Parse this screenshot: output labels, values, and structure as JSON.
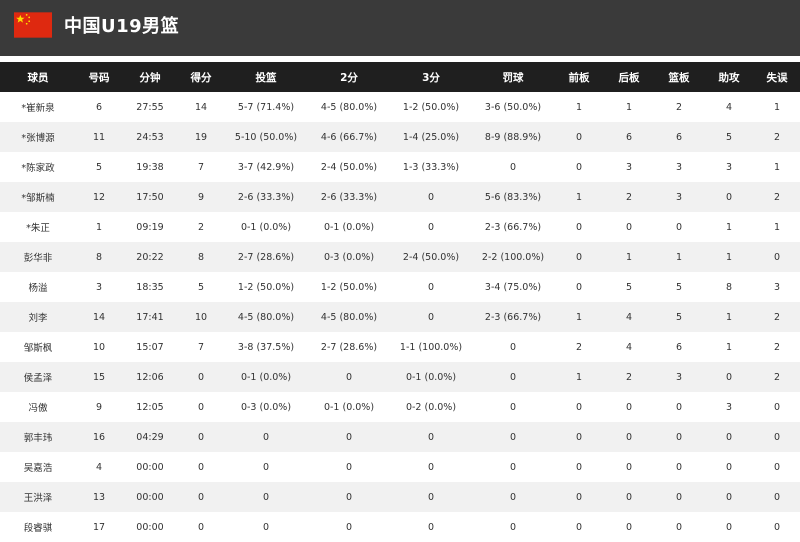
{
  "team": {
    "name": "中国U19男篮",
    "flag_colors": {
      "field": "#de2910",
      "star": "#ffde00"
    }
  },
  "columns": [
    "球员",
    "号码",
    "分钟",
    "得分",
    "投篮",
    "2分",
    "3分",
    "罚球",
    "前板",
    "后板",
    "篮板",
    "助攻",
    "失误"
  ],
  "rows": [
    [
      "*崔新泉",
      "6",
      "27:55",
      "14",
      "5-7 (71.4%)",
      "4-5 (80.0%)",
      "1-2 (50.0%)",
      "3-6 (50.0%)",
      "1",
      "1",
      "2",
      "4",
      "1"
    ],
    [
      "*张博源",
      "11",
      "24:53",
      "19",
      "5-10 (50.0%)",
      "4-6 (66.7%)",
      "1-4 (25.0%)",
      "8-9 (88.9%)",
      "0",
      "6",
      "6",
      "5",
      "2"
    ],
    [
      "*陈家政",
      "5",
      "19:38",
      "7",
      "3-7 (42.9%)",
      "2-4 (50.0%)",
      "1-3 (33.3%)",
      "0",
      "0",
      "3",
      "3",
      "3",
      "1"
    ],
    [
      "*邹斯楠",
      "12",
      "17:50",
      "9",
      "2-6 (33.3%)",
      "2-6 (33.3%)",
      "0",
      "5-6 (83.3%)",
      "1",
      "2",
      "3",
      "0",
      "2"
    ],
    [
      "*朱正",
      "1",
      "09:19",
      "2",
      "0-1 (0.0%)",
      "0-1 (0.0%)",
      "0",
      "2-3 (66.7%)",
      "0",
      "0",
      "0",
      "1",
      "1"
    ],
    [
      "彭华非",
      "8",
      "20:22",
      "8",
      "2-7 (28.6%)",
      "0-3 (0.0%)",
      "2-4 (50.0%)",
      "2-2 (100.0%)",
      "0",
      "1",
      "1",
      "1",
      "0"
    ],
    [
      "杨溢",
      "3",
      "18:35",
      "5",
      "1-2 (50.0%)",
      "1-2 (50.0%)",
      "0",
      "3-4 (75.0%)",
      "0",
      "5",
      "5",
      "8",
      "3"
    ],
    [
      "刘李",
      "14",
      "17:41",
      "10",
      "4-5 (80.0%)",
      "4-5 (80.0%)",
      "0",
      "2-3 (66.7%)",
      "1",
      "4",
      "5",
      "1",
      "2"
    ],
    [
      "邹斯枫",
      "10",
      "15:07",
      "7",
      "3-8 (37.5%)",
      "2-7 (28.6%)",
      "1-1 (100.0%)",
      "0",
      "2",
      "4",
      "6",
      "1",
      "2"
    ],
    [
      "侯孟泽",
      "15",
      "12:06",
      "0",
      "0-1 (0.0%)",
      "0",
      "0-1 (0.0%)",
      "0",
      "1",
      "2",
      "3",
      "0",
      "2"
    ],
    [
      "冯傲",
      "9",
      "12:05",
      "0",
      "0-3 (0.0%)",
      "0-1 (0.0%)",
      "0-2 (0.0%)",
      "0",
      "0",
      "0",
      "0",
      "3",
      "0"
    ],
    [
      "郭丰玮",
      "16",
      "04:29",
      "0",
      "0",
      "0",
      "0",
      "0",
      "0",
      "0",
      "0",
      "0",
      "0"
    ],
    [
      "吴嘉浩",
      "4",
      "00:00",
      "0",
      "0",
      "0",
      "0",
      "0",
      "0",
      "0",
      "0",
      "0",
      "0"
    ],
    [
      "王洪泽",
      "13",
      "00:00",
      "0",
      "0",
      "0",
      "0",
      "0",
      "0",
      "0",
      "0",
      "0",
      "0"
    ],
    [
      "段睿骐",
      "17",
      "00:00",
      "0",
      "0",
      "0",
      "0",
      "0",
      "0",
      "0",
      "0",
      "0",
      "0"
    ]
  ]
}
